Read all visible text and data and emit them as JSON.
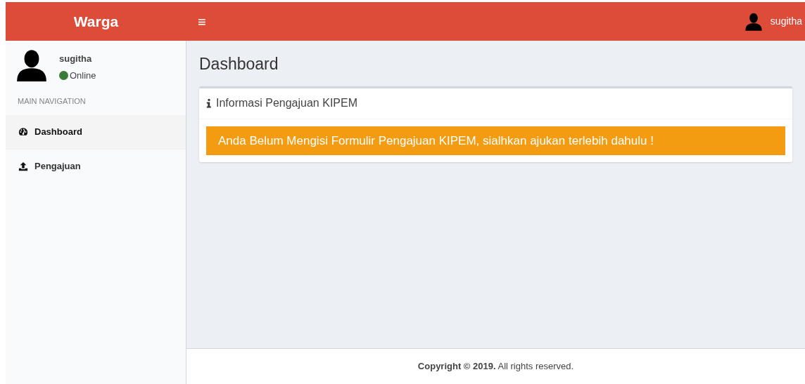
{
  "header": {
    "brand": "Warga",
    "menu_toggle": "≡",
    "user_name": "sugitha"
  },
  "sidebar": {
    "user": {
      "name": "sugitha",
      "status": "Online"
    },
    "section_heading": "MAIN NAVIGATION",
    "items": [
      {
        "label": "Dashboard",
        "selected": true
      },
      {
        "label": "Pengajuan",
        "selected": false
      }
    ]
  },
  "page_title": "Dashboard",
  "info_box": {
    "title": "Informasi Pengajuan KIPEM",
    "alert": "Anda Belum Mengisi Formulir Pengajuan KIPEM, sialhkan ajukan terlebih dahulu !"
  },
  "footer": "**Copyright © 2019.** All rights reserved."
}
